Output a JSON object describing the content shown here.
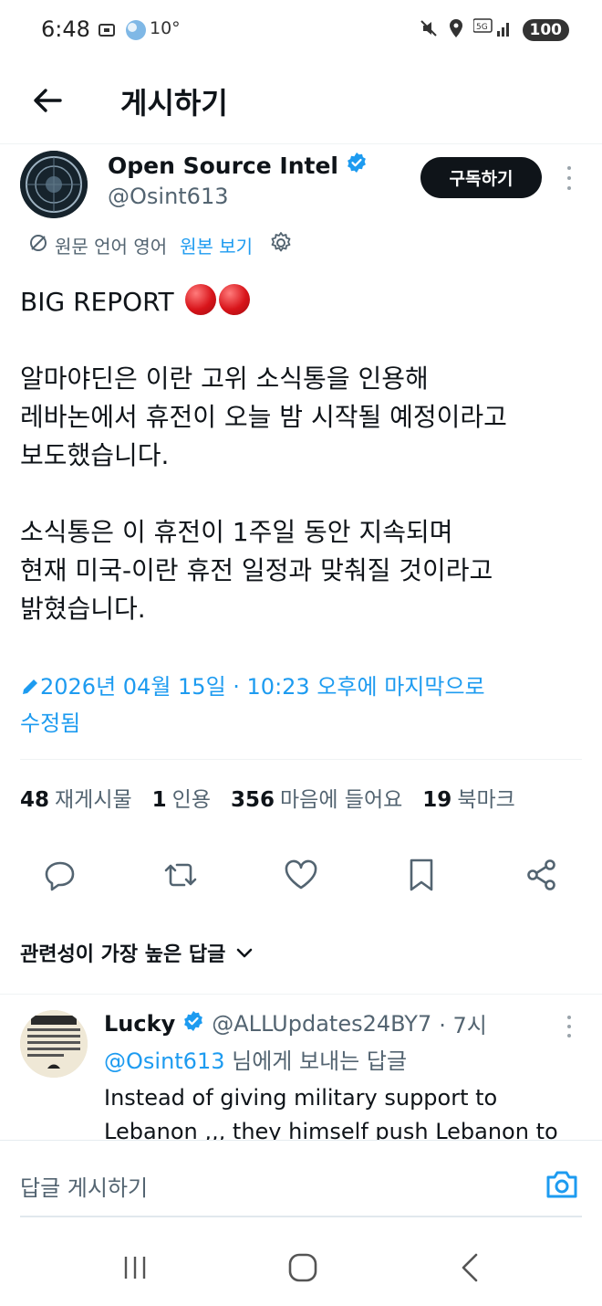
{
  "status_bar": {
    "time": "6:48",
    "temperature": "10°",
    "battery": "100"
  },
  "header": {
    "title": "게시하기"
  },
  "author": {
    "name": "Open Source Intel",
    "handle": "@Osint613",
    "subscribe_label": "구독하기",
    "verified": true
  },
  "translation": {
    "source_label": "원문 언어 영어",
    "view_original_label": "원본 보기"
  },
  "tweet": {
    "headline": "BIG REPORT",
    "paragraph_1": "알마야딘은 이란 고위 소식통을 인용해\n레바논에서 휴전이 오늘 밤 시작될 예정이라고\n보도했습니다.",
    "paragraph_2": "소식통은 이 휴전이 1주일 동안 지속되며\n현재 미국-이란 휴전 일정과 맞춰질 것이라고\n밝혔습니다.",
    "edited_note": "2026년 04월 15일 · 10:23 오후에 마지막으로\n수정됨"
  },
  "stats": {
    "reposts_count": "48",
    "reposts_label": "재게시물",
    "quotes_count": "1",
    "quotes_label": "인용",
    "likes_count": "356",
    "likes_label": "마음에 들어요",
    "bookmarks_count": "19",
    "bookmarks_label": "북마크"
  },
  "sort": {
    "label": "관련성이 가장 높은 답글"
  },
  "reply": {
    "name": "Lucky",
    "handle": "@ALLUpdates24BY7",
    "time": "· 7시",
    "replying_to_handle": "@Osint613",
    "replying_to_suffix": " 님에게 보내는 답글",
    "text": "Instead of giving military support to Lebanon ,,, they himself push Lebanon to"
  },
  "compose": {
    "placeholder": "답글 게시하기"
  },
  "colors": {
    "accent": "#1d9bf0",
    "text_primary": "#0f1419",
    "text_secondary": "#536471"
  }
}
